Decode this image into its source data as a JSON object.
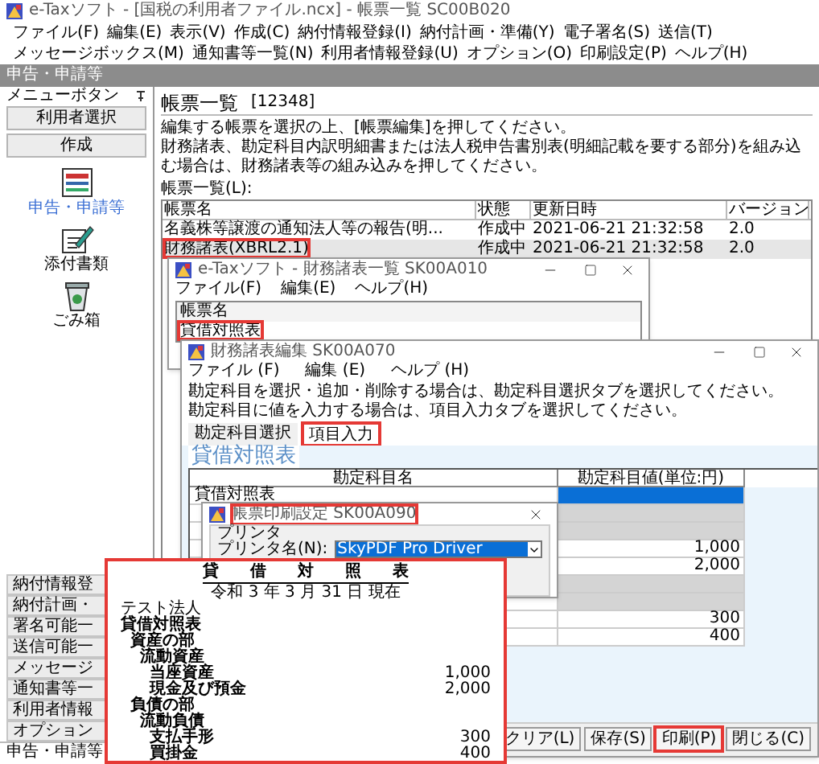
{
  "window": {
    "title": "e-Taxソフト - [国税の利用者ファイル.ncx] - 帳票一覧 SC00B020"
  },
  "menu": [
    "ファイル(F)",
    "編集(E)",
    "表示(V)",
    "作成(C)",
    "納付情報登録(I)",
    "納付計画・準備(Y)",
    "電子署名(S)",
    "送信(T)",
    "メッセージボックス(M)",
    "通知書等一覧(N)",
    "利用者情報登録(U)",
    "オプション(O)",
    "印刷設定(P)",
    "ヘルプ(H)"
  ],
  "section_title": "申告・申請等",
  "sidebar": {
    "header": "メニューボタン",
    "top_buttons": [
      "利用者選択",
      "作成"
    ],
    "items": [
      {
        "label": "申告・申請等",
        "kind": "form",
        "selected": true
      },
      {
        "label": "添付書類",
        "kind": "attach",
        "selected": false
      },
      {
        "label": "ごみ箱",
        "kind": "trash",
        "selected": false
      }
    ],
    "bottom_buttons": [
      "納付情報登",
      "納付計画・",
      "署名可能一",
      "送信可能一",
      "メッセージ",
      "通知書等一",
      "利用者情報",
      "オプション"
    ]
  },
  "main": {
    "title": "帳票一覧",
    "count": "[12348]",
    "instructions": [
      "編集する帳票を選択の上、[帳票編集]を押してください。",
      "財務諸表、勘定科目内訳明細書または法人税申告書別表(明細記載を要する部分)を組み込む場合は、財務諸表等の組み込みを押してください。"
    ],
    "list_label": "帳票一覧(L):",
    "table": {
      "columns": [
        "帳票名",
        "状態",
        "更新日時",
        "バージョン"
      ],
      "rows": [
        {
          "cells": [
            "名義株等譲渡の通知法人等の報告(明...",
            "作成中",
            "2021-06-21 21:32:58",
            "2.0"
          ],
          "selected": false,
          "highlighted": false
        },
        {
          "cells": [
            "財務諸表(XBRL2.1)",
            "作成中",
            "2021-06-21 21:32:58",
            "2.0"
          ],
          "selected": true,
          "highlighted": true
        }
      ]
    }
  },
  "statements_window": {
    "title": "e-Taxソフト - 財務諸表一覧 SK00A010",
    "menu": [
      "ファイル(F)",
      "編集(E)",
      "ヘルプ(H)"
    ],
    "column": "帳票名",
    "items": [
      {
        "label": "貸借対照表",
        "highlighted": true
      }
    ]
  },
  "editor_window": {
    "title": "財務諸表編集 SK00A070",
    "menu": [
      "ファイル (F)",
      "編集 (E)",
      "ヘルプ (H)"
    ],
    "hints": [
      "勘定科目を選択・追加・削除する場合は、勘定科目選択タブを選択してください。",
      "勘定科目に値を入力する場合は、項目入力タブを選択してください。"
    ],
    "tabs": [
      {
        "label": "勘定科目選択",
        "selected": false,
        "highlighted": false
      },
      {
        "label": "項目入力",
        "selected": true,
        "highlighted": true
      }
    ],
    "heading": "貸借対照表",
    "columns": [
      "勘定科目名",
      "勘定科目値(単位:円)"
    ],
    "rows": [
      {
        "name": "貸借対照表",
        "kind": "heading",
        "selected": true
      },
      {
        "kind": "heading",
        "selected": false
      },
      {
        "kind": "heading",
        "selected": false
      },
      {
        "kind": "amount",
        "value": "1,000",
        "selected": false
      },
      {
        "kind": "amount",
        "value": "2,000",
        "selected": false
      },
      {
        "kind": "heading",
        "selected": false
      },
      {
        "kind": "heading",
        "selected": false
      },
      {
        "kind": "amount",
        "value": "300",
        "selected": false
      },
      {
        "kind": "amount",
        "value": "400",
        "selected": false
      }
    ],
    "buttons": [
      {
        "label": "クリア(L)",
        "highlighted": false
      },
      {
        "label": "保存(S)",
        "highlighted": false
      },
      {
        "label": "印刷(P)",
        "highlighted": true
      },
      {
        "label": "閉じる(C)",
        "highlighted": false
      }
    ]
  },
  "print_dialog": {
    "title": "帳票印刷設定 SK00A090",
    "highlighted": true,
    "group": "プリンタ",
    "printer_label": "プリンタ名(N):",
    "printer": "SkyPDF Pro Driver"
  },
  "preview": {
    "highlighted": true,
    "title": "貸 借 対 照 表",
    "date": "令和 3 年 3 月 31 日 現在",
    "company": "テスト法人",
    "items": [
      {
        "label": "貸借対照表",
        "children": [
          {
            "label": "資産の部",
            "children": [
              {
                "label": "流動資産",
                "children": [
                  {
                    "label": "当座資産",
                    "amount": "1,000"
                  },
                  {
                    "label": "現金及び預金",
                    "amount": "2,000"
                  }
                ]
              }
            ]
          },
          {
            "label": "負債の部",
            "children": [
              {
                "label": "流動負債",
                "children": [
                  {
                    "label": "支払手形",
                    "amount": "300"
                  },
                  {
                    "label": "買掛金",
                    "amount": "400"
                  }
                ]
              }
            ]
          }
        ]
      }
    ]
  },
  "status_bar": "申告・申請等"
}
